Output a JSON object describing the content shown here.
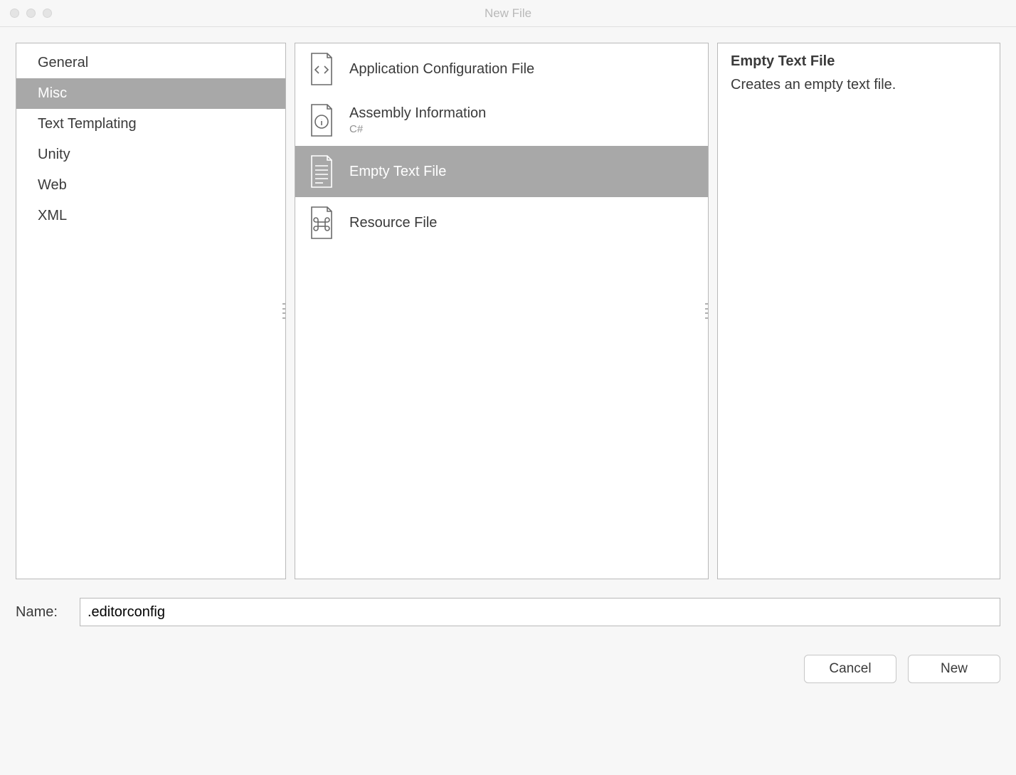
{
  "window": {
    "title": "New File"
  },
  "categories": [
    {
      "label": "General",
      "selected": false
    },
    {
      "label": "Misc",
      "selected": true
    },
    {
      "label": "Text Templating",
      "selected": false
    },
    {
      "label": "Unity",
      "selected": false
    },
    {
      "label": "Web",
      "selected": false
    },
    {
      "label": "XML",
      "selected": false
    }
  ],
  "templates": [
    {
      "label": "Application Configuration File",
      "sub": "",
      "icon": "code-file-icon",
      "selected": false
    },
    {
      "label": "Assembly Information",
      "sub": "C#",
      "icon": "info-file-icon",
      "selected": false
    },
    {
      "label": "Empty Text File",
      "sub": "",
      "icon": "text-file-icon",
      "selected": true
    },
    {
      "label": "Resource File",
      "sub": "",
      "icon": "command-file-icon",
      "selected": false
    }
  ],
  "description": {
    "title": "Empty Text File",
    "body": "Creates an empty text file."
  },
  "name_field": {
    "label": "Name:",
    "value": ".editorconfig"
  },
  "buttons": {
    "cancel": "Cancel",
    "new": "New"
  }
}
